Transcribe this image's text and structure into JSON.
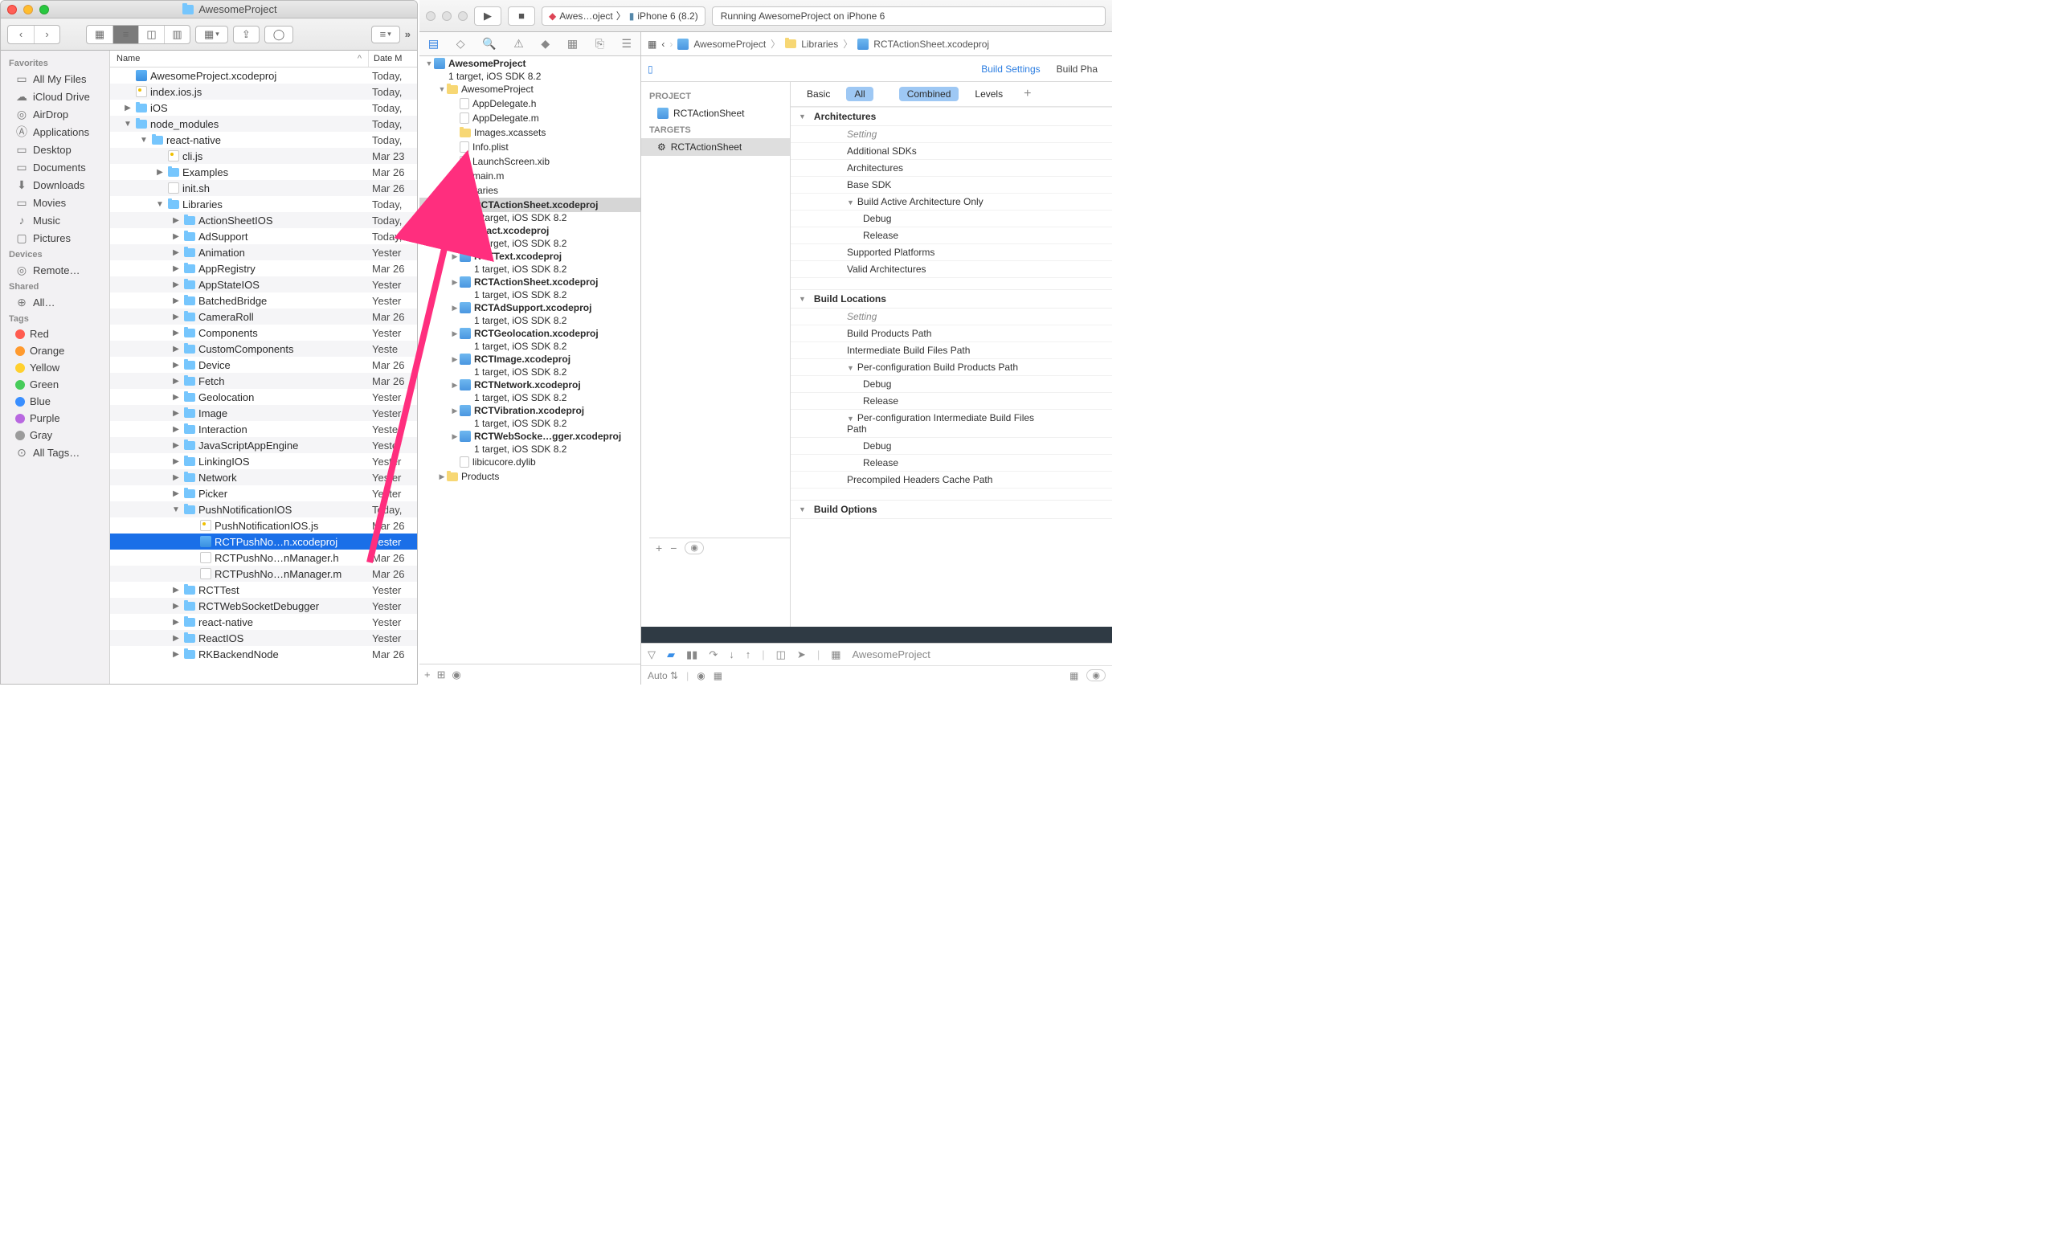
{
  "finder": {
    "title": "AwesomeProject",
    "columns": {
      "name": "Name",
      "date": "Date M"
    },
    "sidebar": {
      "favorites_label": "Favorites",
      "favorites": [
        "All My Files",
        "iCloud Drive",
        "AirDrop",
        "Applications",
        "Desktop",
        "Documents",
        "Downloads",
        "Movies",
        "Music",
        "Pictures"
      ],
      "devices_label": "Devices",
      "devices": [
        "Remote…"
      ],
      "shared_label": "Shared",
      "shared": [
        "All…"
      ],
      "tags_label": "Tags",
      "tags": [
        {
          "label": "Red",
          "color": "#ff5c50"
        },
        {
          "label": "Orange",
          "color": "#ff9a2e"
        },
        {
          "label": "Yellow",
          "color": "#ffd02e"
        },
        {
          "label": "Green",
          "color": "#47cc5a"
        },
        {
          "label": "Blue",
          "color": "#3a8fff"
        },
        {
          "label": "Purple",
          "color": "#b868e0"
        },
        {
          "label": "Gray",
          "color": "#9b9b9b"
        },
        {
          "label": "All Tags…",
          "color": ""
        }
      ]
    },
    "rows": [
      {
        "indent": 0,
        "disc": "",
        "icon": "proj",
        "name": "AwesomeProject.xcodeproj",
        "date": "Today,"
      },
      {
        "indent": 0,
        "disc": "",
        "icon": "js",
        "name": "index.ios.js",
        "date": "Today,"
      },
      {
        "indent": 0,
        "disc": "▶",
        "icon": "folder",
        "name": "iOS",
        "date": "Today,"
      },
      {
        "indent": 0,
        "disc": "▼",
        "icon": "folder",
        "name": "node_modules",
        "date": "Today,"
      },
      {
        "indent": 1,
        "disc": "▼",
        "icon": "folder",
        "name": "react-native",
        "date": "Today,"
      },
      {
        "indent": 2,
        "disc": "",
        "icon": "js",
        "name": "cli.js",
        "date": "Mar 23"
      },
      {
        "indent": 2,
        "disc": "▶",
        "icon": "folder",
        "name": "Examples",
        "date": "Mar 26"
      },
      {
        "indent": 2,
        "disc": "",
        "icon": "file",
        "name": "init.sh",
        "date": "Mar 26"
      },
      {
        "indent": 2,
        "disc": "▼",
        "icon": "folder",
        "name": "Libraries",
        "date": "Today,"
      },
      {
        "indent": 3,
        "disc": "▶",
        "icon": "folder",
        "name": "ActionSheetIOS",
        "date": "Today,"
      },
      {
        "indent": 3,
        "disc": "▶",
        "icon": "folder",
        "name": "AdSupport",
        "date": "Today,"
      },
      {
        "indent": 3,
        "disc": "▶",
        "icon": "folder",
        "name": "Animation",
        "date": "Yester"
      },
      {
        "indent": 3,
        "disc": "▶",
        "icon": "folder",
        "name": "AppRegistry",
        "date": "Mar 26"
      },
      {
        "indent": 3,
        "disc": "▶",
        "icon": "folder",
        "name": "AppStateIOS",
        "date": "Yester"
      },
      {
        "indent": 3,
        "disc": "▶",
        "icon": "folder",
        "name": "BatchedBridge",
        "date": "Yester"
      },
      {
        "indent": 3,
        "disc": "▶",
        "icon": "folder",
        "name": "CameraRoll",
        "date": "Mar 26"
      },
      {
        "indent": 3,
        "disc": "▶",
        "icon": "folder",
        "name": "Components",
        "date": "Yester"
      },
      {
        "indent": 3,
        "disc": "▶",
        "icon": "folder",
        "name": "CustomComponents",
        "date": "Yeste"
      },
      {
        "indent": 3,
        "disc": "▶",
        "icon": "folder",
        "name": "Device",
        "date": "Mar 26"
      },
      {
        "indent": 3,
        "disc": "▶",
        "icon": "folder",
        "name": "Fetch",
        "date": "Mar 26"
      },
      {
        "indent": 3,
        "disc": "▶",
        "icon": "folder",
        "name": "Geolocation",
        "date": "Yester"
      },
      {
        "indent": 3,
        "disc": "▶",
        "icon": "folder",
        "name": "Image",
        "date": "Yester"
      },
      {
        "indent": 3,
        "disc": "▶",
        "icon": "folder",
        "name": "Interaction",
        "date": "Yester"
      },
      {
        "indent": 3,
        "disc": "▶",
        "icon": "folder",
        "name": "JavaScriptAppEngine",
        "date": "Yester"
      },
      {
        "indent": 3,
        "disc": "▶",
        "icon": "folder",
        "name": "LinkingIOS",
        "date": "Yester"
      },
      {
        "indent": 3,
        "disc": "▶",
        "icon": "folder",
        "name": "Network",
        "date": "Yester"
      },
      {
        "indent": 3,
        "disc": "▶",
        "icon": "folder",
        "name": "Picker",
        "date": "Yester"
      },
      {
        "indent": 3,
        "disc": "▼",
        "icon": "folder",
        "name": "PushNotificationIOS",
        "date": "Today,"
      },
      {
        "indent": 4,
        "disc": "",
        "icon": "js",
        "name": "PushNotificationIOS.js",
        "date": "Mar 26"
      },
      {
        "indent": 4,
        "disc": "",
        "icon": "proj",
        "name": "RCTPushNo…n.xcodeproj",
        "date": "Yester",
        "selected": true
      },
      {
        "indent": 4,
        "disc": "",
        "icon": "h",
        "name": "RCTPushNo…nManager.h",
        "date": "Mar 26"
      },
      {
        "indent": 4,
        "disc": "",
        "icon": "m",
        "name": "RCTPushNo…nManager.m",
        "date": "Mar 26"
      },
      {
        "indent": 3,
        "disc": "▶",
        "icon": "folder",
        "name": "RCTTest",
        "date": "Yester"
      },
      {
        "indent": 3,
        "disc": "▶",
        "icon": "folder",
        "name": "RCTWebSocketDebugger",
        "date": "Yester"
      },
      {
        "indent": 3,
        "disc": "▶",
        "icon": "folder",
        "name": "react-native",
        "date": "Yester"
      },
      {
        "indent": 3,
        "disc": "▶",
        "icon": "folder",
        "name": "ReactIOS",
        "date": "Yester"
      },
      {
        "indent": 3,
        "disc": "▶",
        "icon": "folder",
        "name": "RKBackendNode",
        "date": "Mar 26"
      }
    ]
  },
  "xcode": {
    "scheme_app": "Awes…oject",
    "scheme_device": "iPhone 6 (8.2)",
    "status": "Running AwesomeProject on iPhone 6",
    "jump": [
      "AwesomeProject",
      "Libraries",
      "RCTActionSheet.xcodeproj"
    ],
    "tabs": {
      "settings": "Build Settings",
      "phases": "Build Pha"
    },
    "project_section": "PROJECT",
    "project_name": "RCTActionSheet",
    "targets_section": "TARGETS",
    "target_name": "RCTActionSheet",
    "filters": {
      "basic": "Basic",
      "all": "All",
      "combined": "Combined",
      "levels": "Levels"
    },
    "nav": [
      {
        "indent": 0,
        "disc": "▼",
        "icon": "proj",
        "primary": "AwesomeProject",
        "sub": "1 target, iOS SDK 8.2",
        "bold": true
      },
      {
        "indent": 1,
        "disc": "▼",
        "icon": "folder",
        "primary": "AwesomeProject"
      },
      {
        "indent": 2,
        "disc": "",
        "icon": "h",
        "primary": "AppDelegate.h"
      },
      {
        "indent": 2,
        "disc": "",
        "icon": "m",
        "primary": "AppDelegate.m"
      },
      {
        "indent": 2,
        "disc": "",
        "icon": "folder",
        "primary": "Images.xcassets"
      },
      {
        "indent": 2,
        "disc": "",
        "icon": "file",
        "primary": "Info.plist"
      },
      {
        "indent": 2,
        "disc": "",
        "icon": "file",
        "primary": "LaunchScreen.xib"
      },
      {
        "indent": 2,
        "disc": "",
        "icon": "m",
        "primary": "main.m"
      },
      {
        "indent": 1,
        "disc": "▼",
        "icon": "folder",
        "primary": "Libraries"
      },
      {
        "indent": 2,
        "disc": "▶",
        "icon": "proj",
        "primary": "RCTActionSheet.xcodeproj",
        "sub": "1 target, iOS SDK 8.2",
        "bold": true,
        "selected": true
      },
      {
        "indent": 2,
        "disc": "▶",
        "icon": "proj",
        "primary": "React.xcodeproj",
        "sub": "1 target, iOS SDK 8.2",
        "bold": true
      },
      {
        "indent": 2,
        "disc": "▶",
        "icon": "proj",
        "primary": "RCTText.xcodeproj",
        "sub": "1 target, iOS SDK 8.2",
        "bold": true
      },
      {
        "indent": 2,
        "disc": "▶",
        "icon": "proj",
        "primary": "RCTActionSheet.xcodeproj",
        "sub": "1 target, iOS SDK 8.2",
        "bold": true
      },
      {
        "indent": 2,
        "disc": "▶",
        "icon": "proj",
        "primary": "RCTAdSupport.xcodeproj",
        "sub": "1 target, iOS SDK 8.2",
        "bold": true
      },
      {
        "indent": 2,
        "disc": "▶",
        "icon": "proj",
        "primary": "RCTGeolocation.xcodeproj",
        "sub": "1 target, iOS SDK 8.2",
        "bold": true
      },
      {
        "indent": 2,
        "disc": "▶",
        "icon": "proj",
        "primary": "RCTImage.xcodeproj",
        "sub": "1 target, iOS SDK 8.2",
        "bold": true
      },
      {
        "indent": 2,
        "disc": "▶",
        "icon": "proj",
        "primary": "RCTNetwork.xcodeproj",
        "sub": "1 target, iOS SDK 8.2",
        "bold": true
      },
      {
        "indent": 2,
        "disc": "▶",
        "icon": "proj",
        "primary": "RCTVibration.xcodeproj",
        "sub": "1 target, iOS SDK 8.2",
        "bold": true
      },
      {
        "indent": 2,
        "disc": "▶",
        "icon": "proj",
        "primary": "RCTWebSocke…gger.xcodeproj",
        "sub": "1 target, iOS SDK 8.2",
        "bold": true
      },
      {
        "indent": 2,
        "disc": "",
        "icon": "file",
        "primary": "libicucore.dylib"
      },
      {
        "indent": 1,
        "disc": "▶",
        "icon": "folder",
        "primary": "Products"
      }
    ],
    "settings": [
      {
        "type": "section",
        "label": "Architectures"
      },
      {
        "type": "head",
        "label": "Setting"
      },
      {
        "type": "row",
        "label": "Additional SDKs"
      },
      {
        "type": "row",
        "label": "Architectures"
      },
      {
        "type": "row",
        "label": "Base SDK"
      },
      {
        "type": "group",
        "label": "Build Active Architecture Only"
      },
      {
        "type": "sub",
        "label": "Debug"
      },
      {
        "type": "sub",
        "label": "Release"
      },
      {
        "type": "row",
        "label": "Supported Platforms"
      },
      {
        "type": "row",
        "label": "Valid Architectures"
      },
      {
        "type": "spacer"
      },
      {
        "type": "section",
        "label": "Build Locations"
      },
      {
        "type": "head",
        "label": "Setting"
      },
      {
        "type": "row",
        "label": "Build Products Path"
      },
      {
        "type": "row",
        "label": "Intermediate Build Files Path"
      },
      {
        "type": "group",
        "label": "Per-configuration Build Products Path"
      },
      {
        "type": "sub",
        "label": "Debug"
      },
      {
        "type": "sub",
        "label": "Release"
      },
      {
        "type": "group",
        "label": "Per-configuration Intermediate Build Files Path"
      },
      {
        "type": "sub",
        "label": "Debug"
      },
      {
        "type": "sub",
        "label": "Release"
      },
      {
        "type": "row",
        "label": "Precompiled Headers Cache Path"
      },
      {
        "type": "spacer"
      },
      {
        "type": "section",
        "label": "Build Options"
      }
    ],
    "debug_project": "AwesomeProject",
    "auto_label": "Auto ⇅"
  }
}
